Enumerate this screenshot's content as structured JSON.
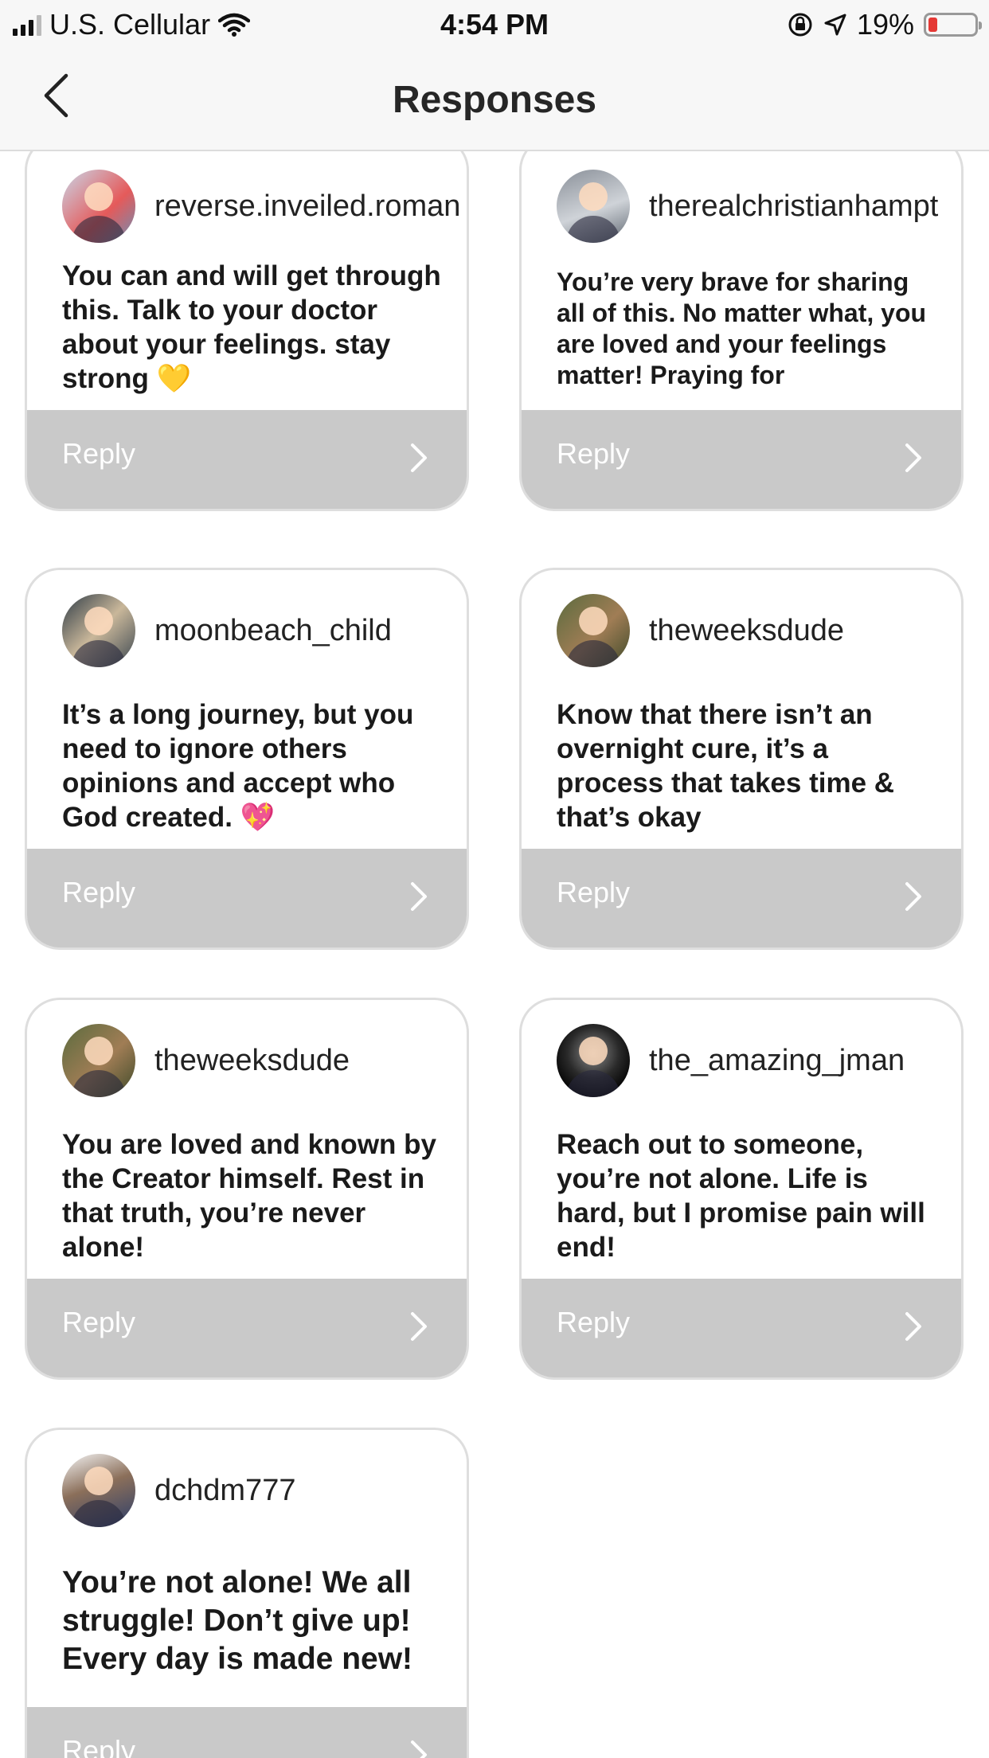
{
  "status_bar": {
    "carrier": "U.S. Cellular",
    "time": "4:54 PM",
    "battery": "19%",
    "battery_level": 0.19,
    "icons": [
      "signal-icon",
      "wifi-icon",
      "orientation-lock-icon",
      "location-arrow-icon",
      "battery-icon"
    ]
  },
  "header": {
    "title": "Responses",
    "back_icon": "chevron-left-icon"
  },
  "responses": [
    {
      "username": "reverse.inveiled.roman",
      "message": "You can and will get through this. Talk to your doctor about your feelings. stay strong 💛",
      "reply_label": "Reply"
    },
    {
      "username": "therealchristianhampt",
      "message": "You’re very brave for sharing all of this. No matter what, you are loved and your feelings matter! Praying for",
      "reply_label": "Reply"
    },
    {
      "username": "moonbeach_child",
      "message": "It’s a long journey, but you need to ignore others opinions and accept who God created. 💖",
      "reply_label": "Reply"
    },
    {
      "username": "theweeksdude",
      "message": "Know that there isn’t an overnight cure, it’s a process that takes time & that’s okay",
      "reply_label": "Reply"
    },
    {
      "username": "theweeksdude",
      "message": "You are loved and known by the Creator himself. Rest in that truth, you’re never alone!",
      "reply_label": "Reply"
    },
    {
      "username": "the_amazing_jman",
      "message": "Reach out to someone, you’re not alone. Life is hard, but I promise pain will end!",
      "reply_label": "Reply"
    },
    {
      "username": "dchdm777",
      "message": "You’re not alone! We all struggle! Don’t give up! Every day is made new!",
      "reply_label": "Reply"
    }
  ],
  "colors": {
    "reply_bar": "#c9c9c9",
    "card_border": "#dedede",
    "header_bg": "#f7f7f7",
    "battery_low": "#e53935"
  }
}
